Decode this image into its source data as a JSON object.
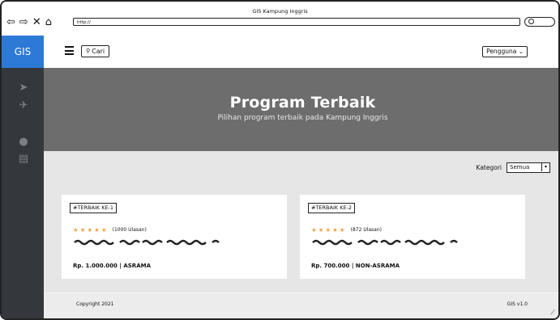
{
  "window": {
    "title": "GIS Kampung Inggris",
    "url": "http://"
  },
  "sidebar": {
    "brand": "GIS"
  },
  "topbar": {
    "search_label": "Cari",
    "user_menu": "Pengguna"
  },
  "hero": {
    "title": "Program Terbaik",
    "subtitle": "Pilihan program terbaik pada Kampung Inggris"
  },
  "filter": {
    "label": "Kategori",
    "selected": "Semua"
  },
  "programs": [
    {
      "badge": "#TERBAIK KE-1",
      "reviews": "(1000 Ulasan)",
      "price": "Rp. 1.000.000 | ASRAMA",
      "rating": 5
    },
    {
      "badge": "#TERBAIK KE-2",
      "reviews": "(872 Ulasan)",
      "price": "Rp. 700.000 | NON-ASRAMA",
      "rating": 5
    }
  ],
  "footer": {
    "copyright": "Copyright 2021",
    "version": "GIS v1.0"
  },
  "colors": {
    "brand": "#2d7ad6",
    "sidebar": "#34383d",
    "hero": "#6d6d6d",
    "star": "#f0a54a"
  }
}
